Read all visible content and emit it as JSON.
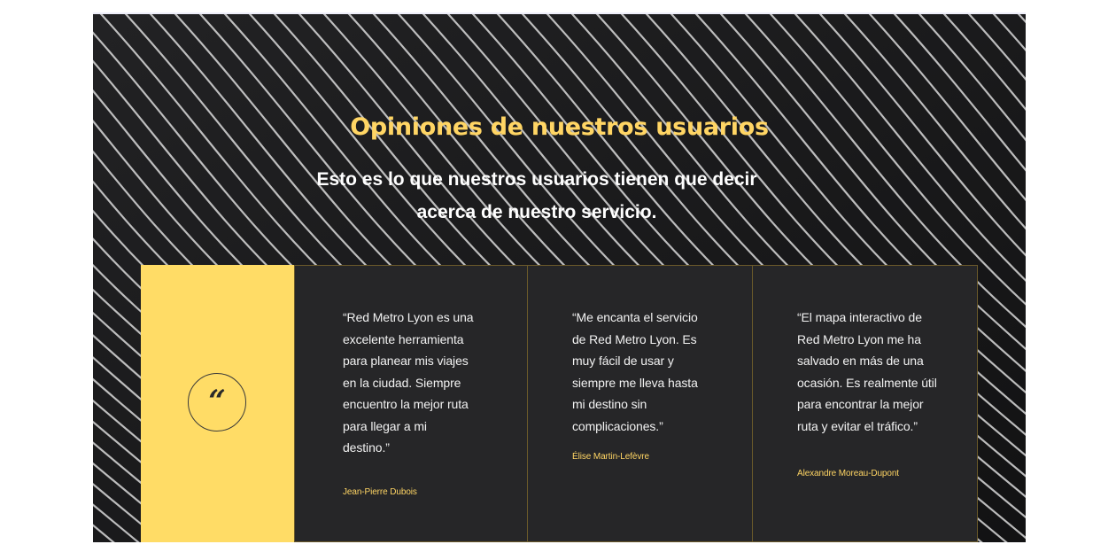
{
  "section": {
    "title": "Opiniones de nuestros usuarios",
    "subtitle": "Esto es lo que nuestros usuarios tienen que decir acerca de nuestro servicio.",
    "quote_icon": "quote-icon",
    "colors": {
      "accent": "#ffd564",
      "panel": "#ffdc66",
      "card": "#262628",
      "background": "#1b1b1d"
    }
  },
  "testimonials": [
    {
      "text": "“Red Metro Lyon es una excelente herramienta para planear mis viajes en la ciudad. Siempre encuentro la mejor ruta para llegar a mi destino.”",
      "author": "Jean-Pierre Dubois"
    },
    {
      "text": "“Me encanta el servicio de Red Metro Lyon. Es muy fácil de usar y siempre me lleva hasta mi destino sin complicaciones.”",
      "author": "Élise Martin-Lefèvre"
    },
    {
      "text": "“El mapa interactivo de Red Metro Lyon me ha salvado en más de una ocasión. Es realmente útil para encontrar la mejor ruta y evitar el tráfico.”",
      "author": "Alexandre Moreau-Dupont"
    }
  ]
}
